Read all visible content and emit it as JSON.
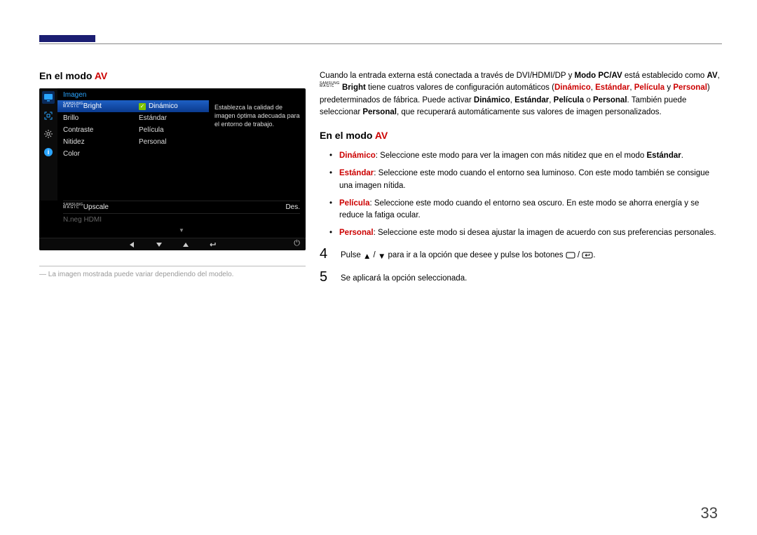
{
  "headings": {
    "av_mode_prefix": "En el modo ",
    "av_mode_suffix": "AV"
  },
  "osd": {
    "title": "Imagen",
    "col1": {
      "bright": "Bright",
      "brillo": "Brillo",
      "contraste": "Contraste",
      "nitidez": "Nitidez",
      "color": "Color"
    },
    "col2": {
      "dinamico": "Dinámico",
      "estandar": "Estándar",
      "pelicula": "Película",
      "personal": "Personal"
    },
    "desc": "Establezca la calidad de imagen óptima adecuada para el entorno de trabajo.",
    "lower": {
      "upscale_label": "Upscale",
      "upscale_value": "Des.",
      "hdmi": "N.neg HDMI"
    },
    "brand_tag": "SAMSUNG",
    "magic": "MAGIC"
  },
  "note": "La imagen mostrada puede variar dependiendo del modelo.",
  "intro": {
    "seg1": "Cuando la entrada externa está conectada a través de DVI/HDMI/DP y ",
    "modo_pcav": "Modo PC/AV",
    "seg2": " está establecido como ",
    "av": "AV",
    "seg3": ", ",
    "bright": "Bright",
    "seg4": " tiene cuatros valores de configuración automáticos (",
    "dinamico": "Dinámico",
    "comma": ", ",
    "estandar": "Estándar",
    "pelicula": "Película",
    "y": " y ",
    "personal": "Personal",
    "seg5": ") predeterminados de fábrica. Puede activar ",
    "seg6": " o ",
    "seg7": ". También puede seleccionar ",
    "seg8": ", que recuperará automáticamente sus valores de imagen personalizados."
  },
  "bullets": {
    "dinamico_label": "Dinámico",
    "dinamico_text": ": Seleccione este modo para ver la imagen con más nitidez que en el modo ",
    "estandar_ref": "Estándar",
    "period": ".",
    "estandar_label": "Estándar",
    "estandar_text": ": Seleccione este modo cuando el entorno sea luminoso. Con este modo también se consigue una imagen nítida.",
    "pelicula_label": "Película",
    "pelicula_text": ": Seleccione este modo cuando el entorno sea oscuro. En este modo se ahorra energía y se reduce la fatiga ocular.",
    "personal_label": "Personal",
    "personal_text": ": Seleccione este modo si desea ajustar la imagen de acuerdo con sus preferencias personales."
  },
  "steps": {
    "n4": "4",
    "step4a": "Pulse ",
    "step4b": " para ir a la opción que desee y pulse los botones ",
    "n5": "5",
    "step5": "Se aplicará la opción seleccionada."
  },
  "pagenum": "33"
}
